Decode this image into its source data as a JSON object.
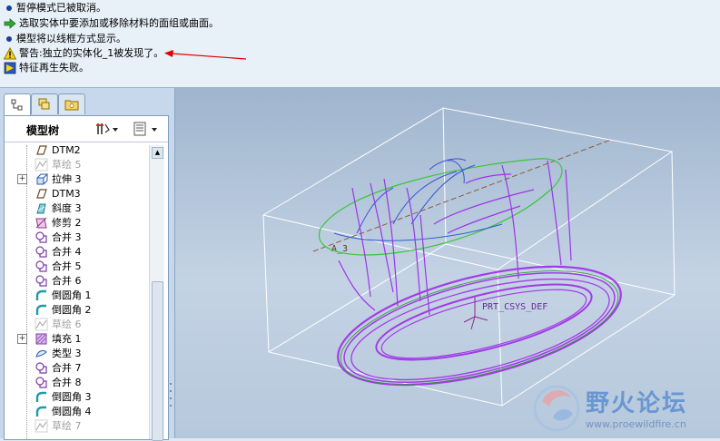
{
  "messages": [
    {
      "type": "info",
      "icon": "info-dot-icon",
      "text": "暂停模式已被取消。"
    },
    {
      "type": "prompt",
      "icon": "green-arrow-icon",
      "text": "选取实体中要添加或移除材料的面组或曲面。"
    },
    {
      "type": "info",
      "icon": "info-dot-icon",
      "text": "模型将以线框方式显示。"
    },
    {
      "type": "warning",
      "icon": "warning-triangle-icon",
      "text": "警告:独立的实体化_1被发现了。"
    },
    {
      "type": "error",
      "icon": "error-flag-icon",
      "text": "特征再生失败。"
    }
  ],
  "model_tree": {
    "title": "模型树",
    "items": [
      {
        "label": "DTM2",
        "icon": "datum-plane-icon",
        "expandable": false,
        "dimmed": false
      },
      {
        "label": "草绘 5",
        "icon": "sketch-icon",
        "expandable": false,
        "dimmed": true
      },
      {
        "label": "拉伸 3",
        "icon": "extrude-icon",
        "expandable": true,
        "dimmed": false
      },
      {
        "label": "DTM3",
        "icon": "datum-plane-icon",
        "expandable": false,
        "dimmed": false
      },
      {
        "label": "斜度 3",
        "icon": "draft-icon",
        "expandable": false,
        "dimmed": false
      },
      {
        "label": "修剪 2",
        "icon": "trim-icon",
        "expandable": false,
        "dimmed": false
      },
      {
        "label": "合并 3",
        "icon": "merge-icon",
        "expandable": false,
        "dimmed": false
      },
      {
        "label": "合并 4",
        "icon": "merge-icon",
        "expandable": false,
        "dimmed": false
      },
      {
        "label": "合并 5",
        "icon": "merge-icon",
        "expandable": false,
        "dimmed": false
      },
      {
        "label": "合并 6",
        "icon": "merge-icon",
        "expandable": false,
        "dimmed": false
      },
      {
        "label": "倒圆角 1",
        "icon": "round-icon",
        "expandable": false,
        "dimmed": false
      },
      {
        "label": "倒圆角 2",
        "icon": "round-icon",
        "expandable": false,
        "dimmed": false
      },
      {
        "label": "草绘 6",
        "icon": "sketch-icon",
        "expandable": false,
        "dimmed": true
      },
      {
        "label": "填充 1",
        "icon": "fill-icon",
        "expandable": true,
        "dimmed": false
      },
      {
        "label": "类型 3",
        "icon": "style-icon",
        "expandable": false,
        "dimmed": false
      },
      {
        "label": "合并 7",
        "icon": "merge-icon",
        "expandable": false,
        "dimmed": false
      },
      {
        "label": "合并 8",
        "icon": "merge-icon",
        "expandable": false,
        "dimmed": false
      },
      {
        "label": "倒圆角 3",
        "icon": "round-icon",
        "expandable": false,
        "dimmed": false
      },
      {
        "label": "倒圆角 4",
        "icon": "round-icon",
        "expandable": false,
        "dimmed": false
      },
      {
        "label": "草绘 7",
        "icon": "sketch-icon",
        "expandable": false,
        "dimmed": true
      }
    ]
  },
  "viewport": {
    "csys_label": "PRT_CSYS_DEF",
    "axis_label": "A_3"
  },
  "watermark": {
    "text": "野火论坛",
    "url": "www.proewildfire.cn"
  },
  "colors": {
    "accent": "#1b3fa0",
    "warning": "#f2d21b",
    "model_wire": "#8a2be2",
    "annotation_arrow": "#e00000"
  }
}
